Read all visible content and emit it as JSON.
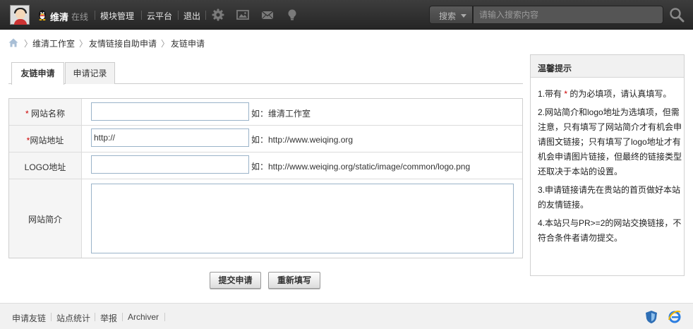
{
  "topbar": {
    "username": "维清",
    "status": "在线",
    "nav": [
      "模块管理",
      "云平台",
      "退出"
    ],
    "icons": [
      "gear-icon",
      "image-icon",
      "mail-icon",
      "bulb-icon"
    ],
    "search_scope": "搜索",
    "search_placeholder": "请输入搜索内容"
  },
  "breadcrumb": [
    "维清工作室",
    "友情链接自助申请",
    "友链申请"
  ],
  "tabs": [
    "友链申请",
    "申请记录"
  ],
  "form": {
    "required_mark": "*",
    "site_name_label": "网站名称",
    "site_name_value": "",
    "site_name_hint": "如：维清工作室",
    "site_url_label": "网站地址",
    "site_url_value": "http://",
    "site_url_hint": "如：http://www.weiqing.org",
    "logo_label": "LOGO地址",
    "logo_value": "",
    "logo_hint": "如：http://www.weiqing.org/static/image/common/logo.png",
    "intro_label": "网站简介",
    "intro_value": ""
  },
  "buttons": {
    "submit": "提交申请",
    "reset": "重新填写"
  },
  "tips": {
    "title": "温馨提示",
    "t1_pre": "1.带有 ",
    "t1_mark": "*",
    "t1_post": " 的为必填项，请认真填写。",
    "t2": "2.网站简介和logo地址为选填项，但需注意，只有填写了网站简介才有机会申请图文链接；只有填写了logo地址才有机会申请图片链接，但最终的链接类型还取决于本站的设置。",
    "t3": "3.申请链接请先在贵站的首页做好本站的友情链接。",
    "t4": "4.本站只与PR>=2的网站交换链接，不符合条件者请勿提交。"
  },
  "footer": {
    "links": [
      "申请友链",
      "站点统计",
      "举报",
      "Archiver"
    ]
  },
  "colors": {
    "required": "#cc0000",
    "topbar": "#2e2e2e"
  }
}
